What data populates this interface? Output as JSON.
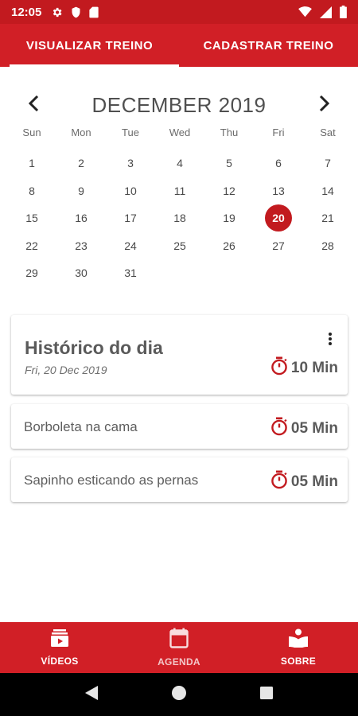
{
  "status_bar": {
    "time": "12:05",
    "icons_left": [
      "gear-icon",
      "shield-icon",
      "sd-card-icon"
    ],
    "icons_right": [
      "wifi-icon",
      "signal-icon",
      "battery-icon"
    ]
  },
  "tabs": [
    {
      "label": "VISUALIZAR TREINO",
      "active": true
    },
    {
      "label": "CADASTRAR TREINO",
      "active": false
    }
  ],
  "calendar": {
    "month_label": "DECEMBER 2019",
    "prev_icon": "chevron-left-icon",
    "next_icon": "chevron-right-icon",
    "weekdays": [
      "Sun",
      "Mon",
      "Tue",
      "Wed",
      "Thu",
      "Fri",
      "Sat"
    ],
    "weeks": [
      [
        "1",
        "2",
        "3",
        "4",
        "5",
        "6",
        "7"
      ],
      [
        "8",
        "9",
        "10",
        "11",
        "12",
        "13",
        "14"
      ],
      [
        "15",
        "16",
        "17",
        "18",
        "19",
        "20",
        "21"
      ],
      [
        "22",
        "23",
        "24",
        "25",
        "26",
        "27",
        "28"
      ],
      [
        "29",
        "30",
        "31",
        "",
        "",
        "",
        ""
      ]
    ],
    "selected_day": "20"
  },
  "history": {
    "title": "Histórico do dia",
    "date": "Fri, 20 Dec 2019",
    "total_duration": "10 Min",
    "more_icon": "more-vertical-icon",
    "items": [
      {
        "name": "Borboleta na cama",
        "duration": "05 Min"
      },
      {
        "name": "Sapinho esticando as pernas",
        "duration": "05 Min"
      }
    ]
  },
  "bottom_nav": [
    {
      "label": "VÍDEOS",
      "icon": "video-library-icon"
    },
    {
      "label": "AGENDA",
      "icon": "calendar-icon"
    },
    {
      "label": "SOBRE",
      "icon": "book-reader-icon"
    }
  ],
  "system_nav": [
    "back-icon",
    "home-icon",
    "recents-icon"
  ],
  "colors": {
    "accent": "#d11f26",
    "status_bar": "#c21a1f",
    "selected_day": "#c21a1f",
    "timer_icon": "#c21a1f",
    "text": "#5a5a5a"
  }
}
